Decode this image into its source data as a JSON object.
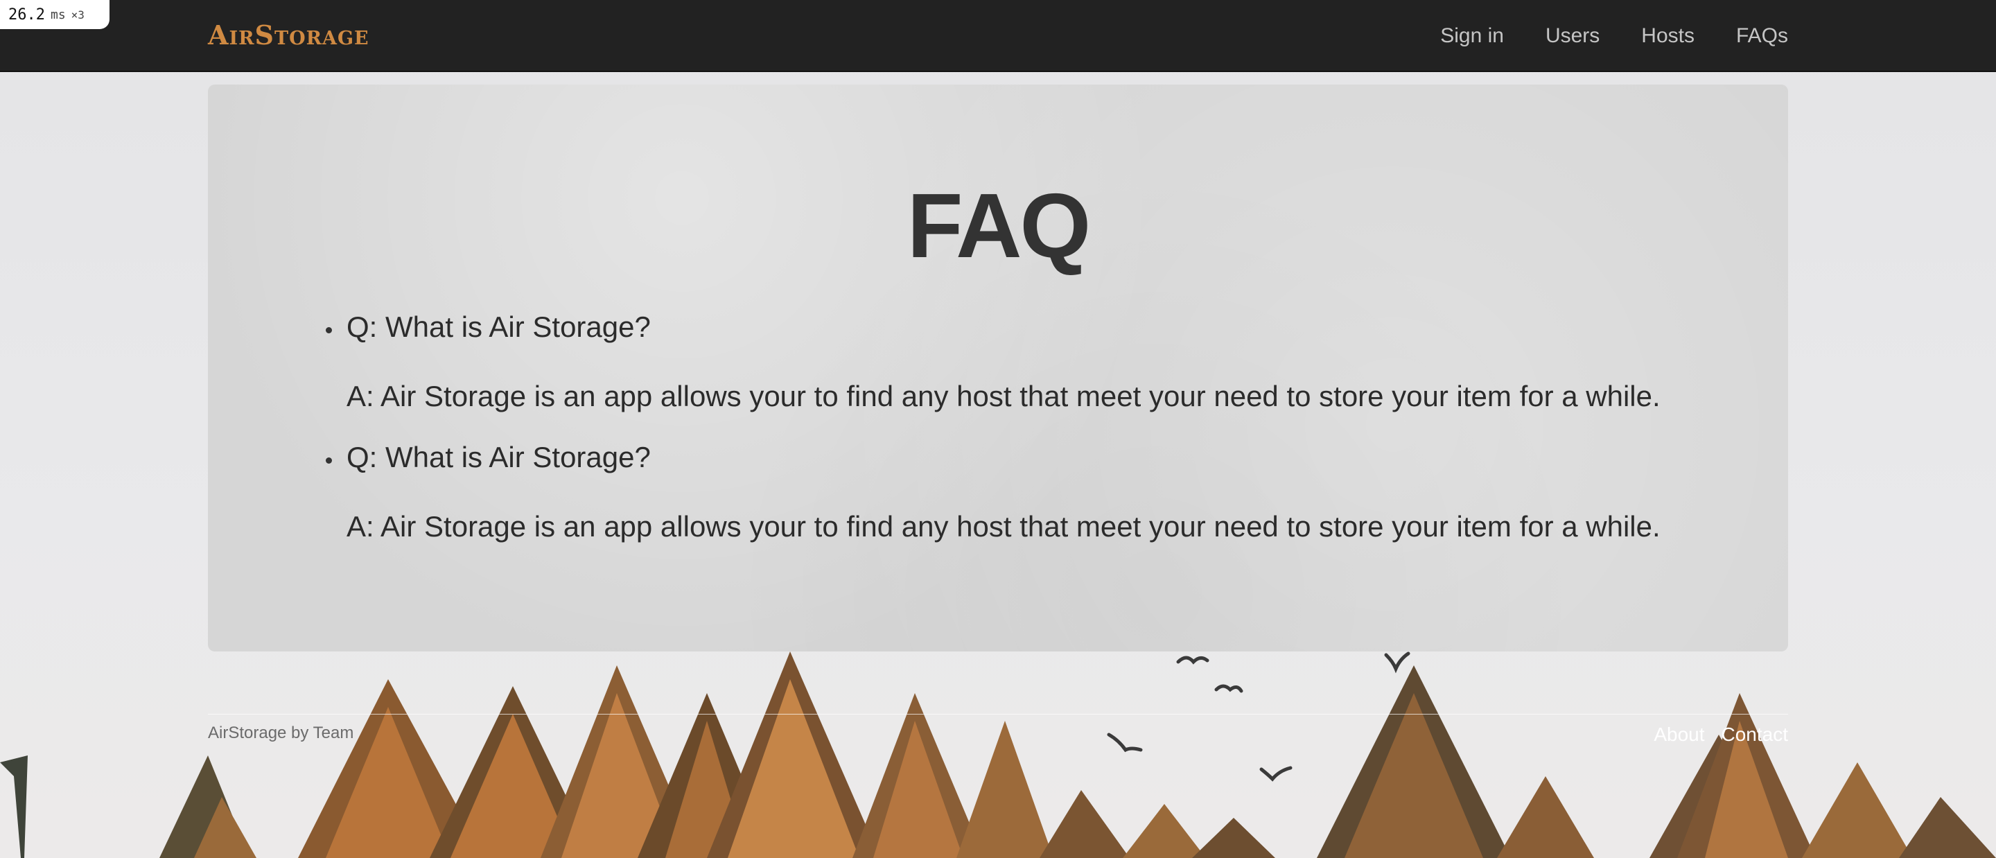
{
  "perf_badge": {
    "value": "26.2",
    "unit": "ms",
    "multiplier": "×3"
  },
  "navbar": {
    "brand": "AirStorage",
    "links": [
      {
        "label": "Sign in"
      },
      {
        "label": "Users"
      },
      {
        "label": "Hosts"
      },
      {
        "label": "FAQs"
      }
    ]
  },
  "faq": {
    "title": "FAQ",
    "items": [
      {
        "question": "Q: What is Air Storage?",
        "answer": "A: Air Storage is an app allows your to find any host that meet your need to store your item for a while."
      },
      {
        "question": "Q: What is Air Storage?",
        "answer": "A: Air Storage is an app allows your to find any host that meet your need to store your item for a while."
      }
    ]
  },
  "footer": {
    "credit": "AirStorage by Team",
    "links": [
      {
        "label": "About"
      },
      {
        "label": "Contact"
      }
    ]
  },
  "colors": {
    "navbar_bg": "#222222",
    "brand": "#d08a42",
    "card_bg": "#d6d6d6",
    "heading": "#333333",
    "tree_orange": "#b8743a",
    "tree_dark": "#4a4a3a"
  }
}
